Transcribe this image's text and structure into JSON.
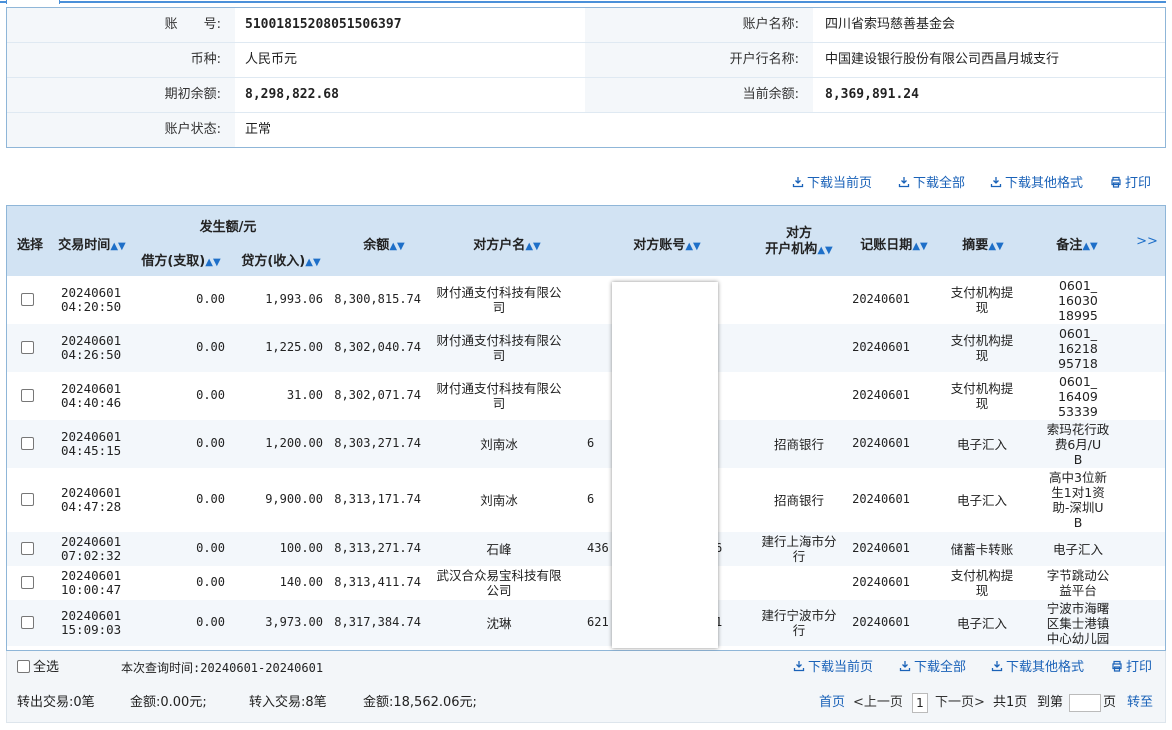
{
  "account": {
    "number_label": "账　　号:",
    "number": "51001815208051506397",
    "name_label": "账户名称:",
    "name": "四川省索玛慈善基金会",
    "currency_label": "币种:",
    "currency": "人民币元",
    "bank_label": "开户行名称:",
    "bank": "中国建设银行股份有限公司西昌月城支行",
    "opening_label": "期初余额:",
    "opening": "8,298,822.68",
    "current_label": "当前余额:",
    "current": "8,369,891.24",
    "status_label": "账户状态:",
    "status": "正常"
  },
  "actions": {
    "download_page": "下载当前页",
    "download_all": "下载全部",
    "download_other": "下载其他格式",
    "print": "打印"
  },
  "table": {
    "headers": {
      "select": "选择",
      "time": "交易时间",
      "amount_group": "发生额/元",
      "debit": "借方(支取)",
      "credit": "贷方(收入)",
      "balance": "余额",
      "party_name": "对方户名",
      "party_account": "对方账号",
      "party_bank_line1": "对方",
      "party_bank_line2": "开户机构",
      "post_date": "记账日期",
      "summary": "摘要",
      "remark": "备注",
      "more": ">>"
    },
    "rows": [
      {
        "date": "20240601",
        "time": "04:20:50",
        "debit": "0.00",
        "credit": "1,993.06",
        "balance": "8,300,815.74",
        "name": [
          "财付通支付科技有限公",
          "司"
        ],
        "acct": "",
        "bank": [],
        "post": "20240601",
        "summary": [
          "支付机构提",
          "现"
        ],
        "remark": [
          "0601_",
          "16030",
          "18995"
        ]
      },
      {
        "date": "20240601",
        "time": "04:26:50",
        "debit": "0.00",
        "credit": "1,225.00",
        "balance": "8,302,040.74",
        "name": [
          "财付通支付科技有限公",
          "司"
        ],
        "acct": "",
        "bank": [],
        "post": "20240601",
        "summary": [
          "支付机构提",
          "现"
        ],
        "remark": [
          "0601_",
          "16218",
          "95718"
        ]
      },
      {
        "date": "20240601",
        "time": "04:40:46",
        "debit": "0.00",
        "credit": "31.00",
        "balance": "8,302,071.74",
        "name": [
          "财付通支付科技有限公",
          "司"
        ],
        "acct": "",
        "bank": [],
        "post": "20240601",
        "summary": [
          "支付机构提",
          "现"
        ],
        "remark": [
          "0601_",
          "16409",
          "53339"
        ]
      },
      {
        "date": "20240601",
        "time": "04:45:15",
        "debit": "0.00",
        "credit": "1,200.00",
        "balance": "8,303,271.74",
        "name": [
          "刘南冰"
        ],
        "acct": "6",
        "bank": [
          "招商银行"
        ],
        "post": "20240601",
        "summary": [
          "电子汇入"
        ],
        "remark": [
          "索玛花行政",
          "费6月/U",
          "B"
        ]
      },
      {
        "date": "20240601",
        "time": "04:47:28",
        "debit": "0.00",
        "credit": "9,900.00",
        "balance": "8,313,171.74",
        "name": [
          "刘南冰"
        ],
        "acct": "6",
        "bank": [
          "招商银行"
        ],
        "post": "20240601",
        "summary": [
          "电子汇入"
        ],
        "remark": [
          "高中3位新",
          "生1对1资",
          "助-深圳U",
          "B"
        ]
      },
      {
        "date": "20240601",
        "time": "07:02:32",
        "debit": "0.00",
        "credit": "100.00",
        "balance": "8,313,271.74",
        "name": [
          "石峰"
        ],
        "acct": "436",
        "acct_tail": "6",
        "bank": [
          "建行上海市分",
          "行"
        ],
        "post": "20240601",
        "summary": [
          "储蓄卡转账"
        ],
        "remark": [
          "电子汇入"
        ]
      },
      {
        "date": "20240601",
        "time": "10:00:47",
        "debit": "0.00",
        "credit": "140.00",
        "balance": "8,313,411.74",
        "name": [
          "武汉合众易宝科技有限",
          "公司"
        ],
        "acct": "",
        "bank": [],
        "post": "20240601",
        "summary": [
          "支付机构提",
          "现"
        ],
        "remark": [
          "字节跳动公",
          "益平台"
        ]
      },
      {
        "date": "20240601",
        "time": "15:09:03",
        "debit": "0.00",
        "credit": "3,973.00",
        "balance": "8,317,384.74",
        "name": [
          "沈琳"
        ],
        "acct": "621",
        "acct_tail": "1",
        "bank": [
          "建行宁波市分",
          "行"
        ],
        "post": "20240601",
        "summary": [
          "电子汇入"
        ],
        "remark": [
          "宁波市海曙",
          "区集士港镇",
          "中心幼儿园"
        ]
      }
    ]
  },
  "footer": {
    "select_all": "全选",
    "query_time": "本次查询时间:20240601-20240601",
    "out_label": "转出交易:0笔",
    "out_amount": "金额:0.00元;",
    "in_label": "转入交易:8笔",
    "in_amount": "金额:18,562.06元;",
    "pager": {
      "first": "首页",
      "prev": "<上一页",
      "current_page": "1",
      "next": "下一页>",
      "total": "共1页",
      "goto_prefix": "到第",
      "goto_suffix": "页",
      "go": "转至"
    }
  },
  "colors": {
    "header_bg": "#d2e3f3",
    "accent": "#1a62b8",
    "border": "#8fb6d8"
  }
}
